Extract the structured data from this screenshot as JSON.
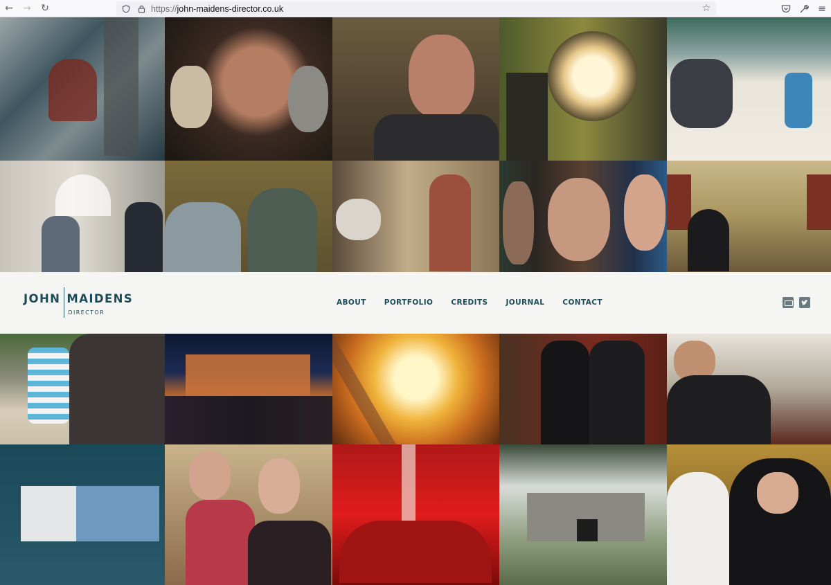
{
  "browser": {
    "url_proto": "https://",
    "url_host": "john-maidens-director.co.uk",
    "icons": [
      "back-arrow-icon",
      "forward-arrow-icon",
      "reload-icon",
      "shield-icon",
      "lock-icon",
      "bookmark-star-icon",
      "pocket-icon",
      "extensions-icon",
      "menu-icon"
    ]
  },
  "logo": {
    "first": "JOHN",
    "last": "MAIDENS",
    "subtitle": "DIRECTOR"
  },
  "nav": {
    "about": "ABOUT",
    "portfolio": "PORTFOLIO",
    "credits": "CREDITS",
    "journal": "JOURNAL",
    "contact": "CONTACT"
  },
  "social": [
    "vimeo-icon",
    "twitter-icon"
  ],
  "colors": {
    "brand": "#1d4b57",
    "band": "#f5f5f3",
    "chrome": "#f9f9fb"
  }
}
